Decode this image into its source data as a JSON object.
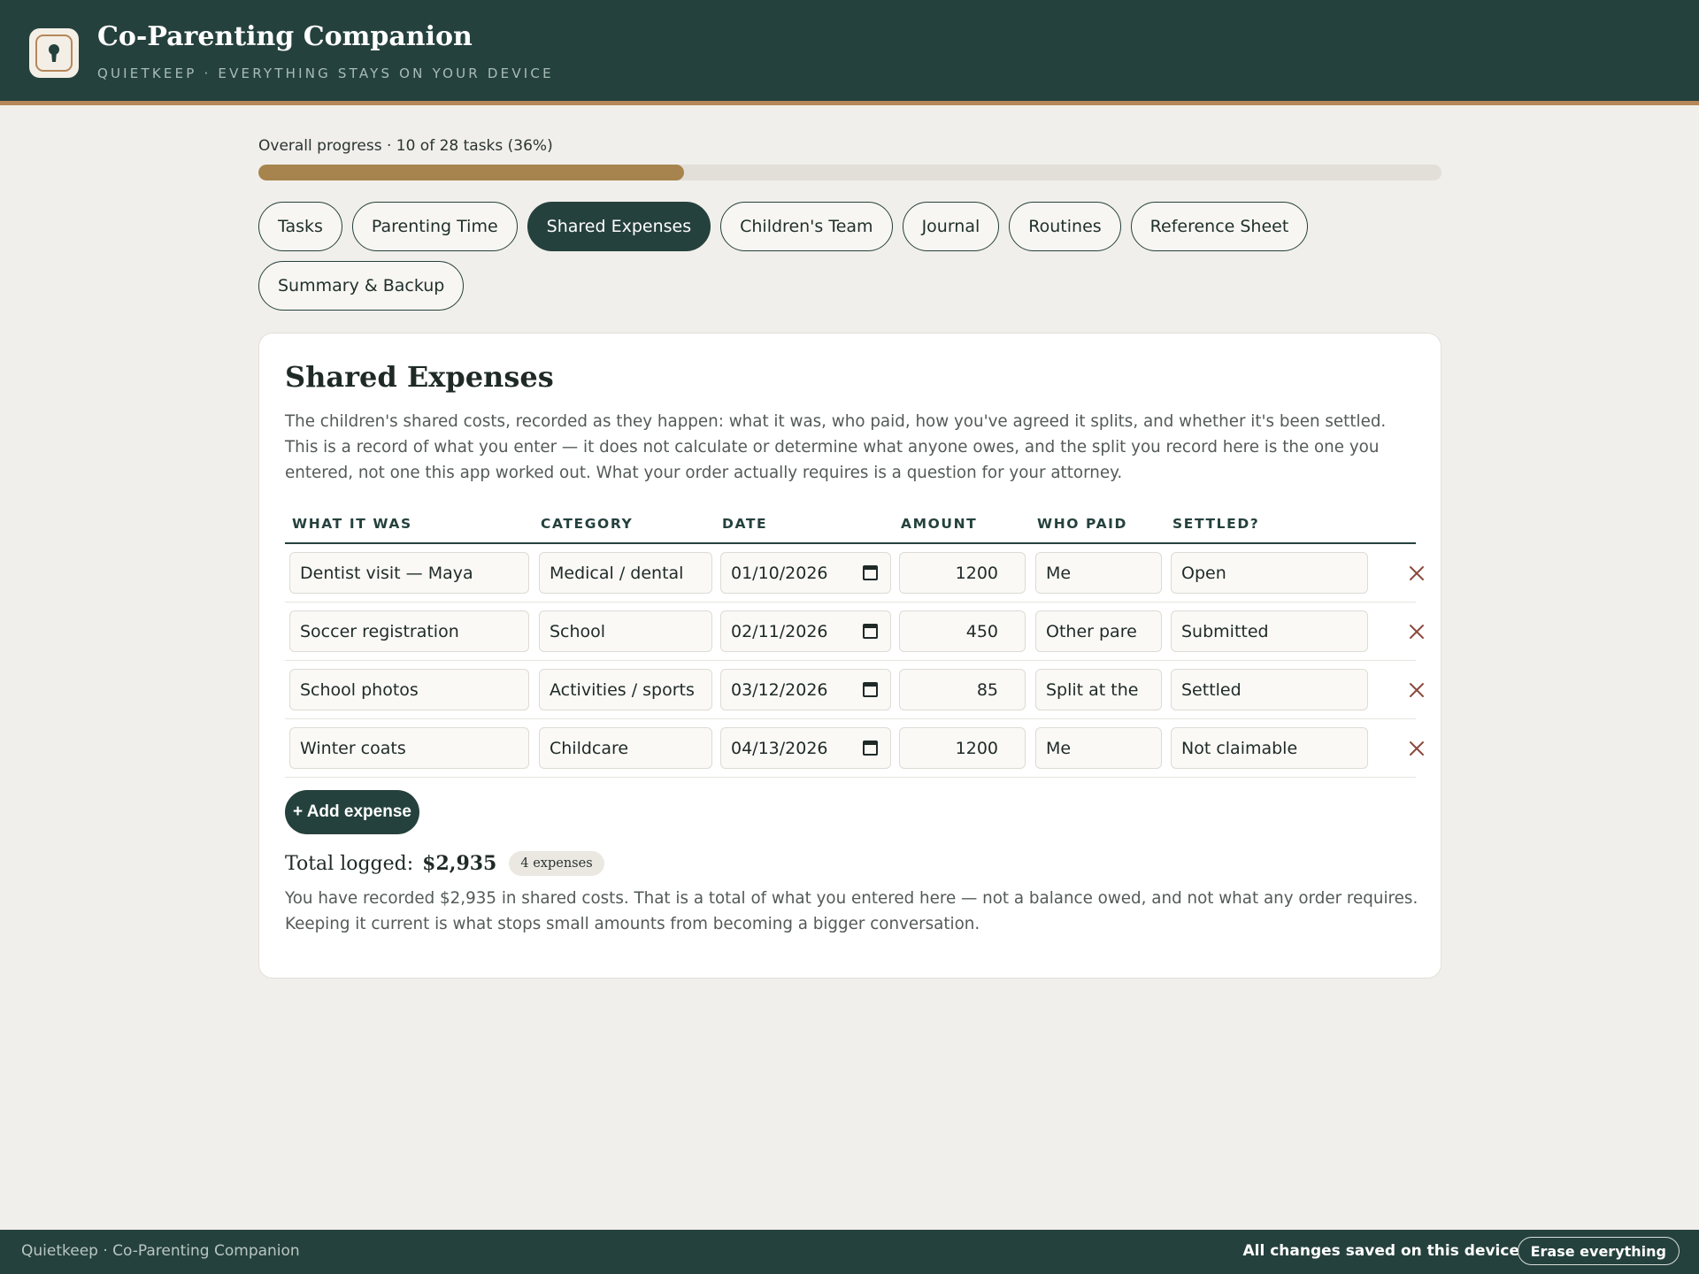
{
  "header": {
    "title": "Co-Parenting Companion",
    "subtitle": "QUIETKEEP · EVERYTHING STAYS ON YOUR DEVICE"
  },
  "progress": {
    "label": "Overall progress · 10 of 28 tasks (36%)",
    "fraction": 0.36
  },
  "tabs": [
    {
      "label": "Tasks",
      "active": false
    },
    {
      "label": "Parenting Time",
      "active": false
    },
    {
      "label": "Shared Expenses",
      "active": true
    },
    {
      "label": "Children's Team",
      "active": false
    },
    {
      "label": "Journal",
      "active": false
    },
    {
      "label": "Routines",
      "active": false
    },
    {
      "label": "Reference Sheet",
      "active": false
    },
    {
      "label": "Summary & Backup",
      "active": false
    }
  ],
  "section": {
    "title": "Shared Expenses",
    "description": "The children's shared costs, recorded as they happen: what it was, who paid, how you've agreed it splits, and whether it's been settled. This is a record of what you enter — it does not calculate or determine what anyone owes, and the split you record here is the one you entered, not one this app worked out. What your order actually requires is a question for your attorney."
  },
  "table": {
    "columns": [
      "WHAT IT WAS",
      "CATEGORY",
      "DATE",
      "AMOUNT",
      "WHO PAID",
      "SETTLED?"
    ],
    "rows": [
      {
        "what": "Dentist visit — Maya",
        "category": "Medical / dental",
        "date": "01/10/2026",
        "amount": "1200",
        "who_paid": "Me",
        "settled": "Open"
      },
      {
        "what": "Soccer registration",
        "category": "School",
        "date": "02/11/2026",
        "amount": "450",
        "who_paid": "Other pare",
        "settled": "Submitted"
      },
      {
        "what": "School photos",
        "category": "Activities / sports",
        "date": "03/12/2026",
        "amount": "85",
        "who_paid": "Split at the",
        "settled": "Settled"
      },
      {
        "what": "Winter coats",
        "category": "Childcare",
        "date": "04/13/2026",
        "amount": "1200",
        "who_paid": "Me",
        "settled": "Not claimable"
      }
    ]
  },
  "add_button_label": "+ Add expense",
  "totals": {
    "label": "Total logged:",
    "value": "$2,935",
    "count_badge": "4 expenses",
    "note": "You have recorded $2,935 in shared costs. That is a total of what you entered here — not a balance owed, and not what any order requires. Keeping it current is what stops small amounts from becoming a bigger conversation."
  },
  "footer": {
    "left": "Quietkeep · Co-Parenting Companion",
    "status": "All changes saved on this device",
    "erase_label": "Erase everything"
  },
  "colors": {
    "primary": "#25413d",
    "accent": "#b5875a",
    "progress": "#a7844d",
    "background": "#f1efeb"
  },
  "icons": {
    "logo": "keyhole-icon",
    "row_delete": "close-icon",
    "date_picker": "calendar-icon"
  }
}
